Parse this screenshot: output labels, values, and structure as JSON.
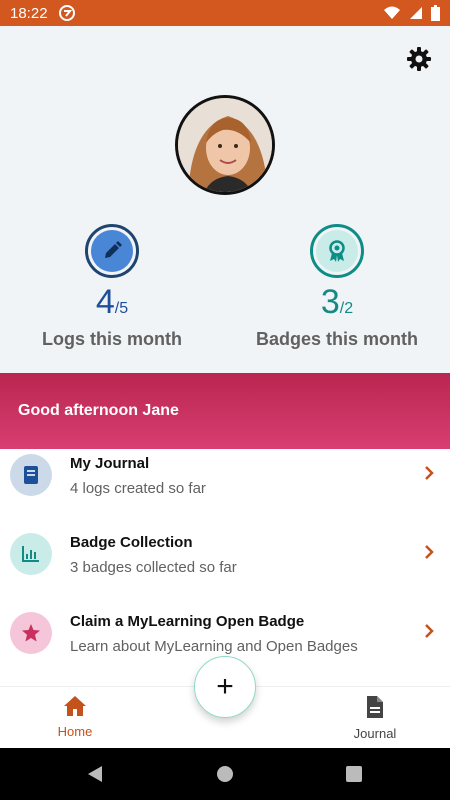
{
  "status_bar": {
    "time": "18:22"
  },
  "stats": {
    "logs": {
      "count": "4",
      "total": "/5",
      "label": "Logs this month"
    },
    "badges": {
      "count": "3",
      "total": "/2",
      "label": "Badges this month"
    }
  },
  "greeting": "Good afternoon Jane",
  "list": [
    {
      "title": "My Journal",
      "subtitle": "4 logs created so far",
      "icon": "book-icon"
    },
    {
      "title": "Badge Collection",
      "subtitle": "3 badges collected so far",
      "icon": "bar-chart-icon"
    },
    {
      "title": "Claim a MyLearning Open Badge",
      "subtitle": "Learn about MyLearning and Open Badges",
      "icon": "star-icon"
    }
  ],
  "nav": {
    "home": "Home",
    "journal": "Journal"
  },
  "fab": "+",
  "colors": {
    "brand_orange": "#d2581f",
    "greeting_pink": "#c9305f",
    "logs_blue": "#1e4f99",
    "badges_teal": "#138a84"
  }
}
